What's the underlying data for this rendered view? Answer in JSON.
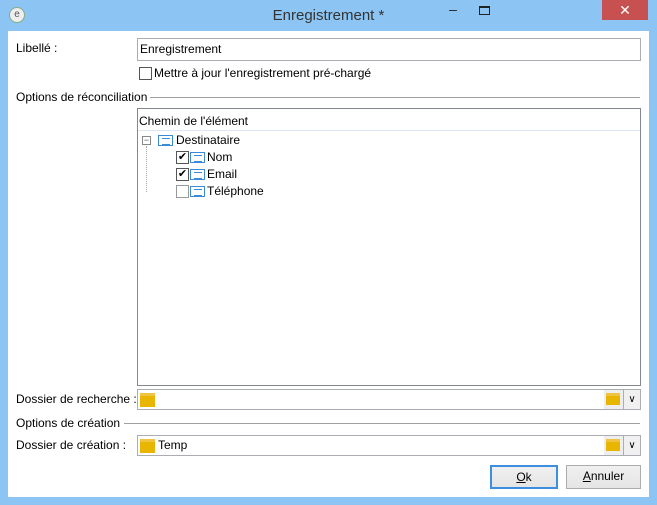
{
  "window": {
    "title": "Enregistrement *",
    "minimize": "‒",
    "close": "✕"
  },
  "form": {
    "label_label": "Libellé :",
    "label_value": "Enregistrement",
    "update_checkbox_label": "Mettre à jour l'enregistrement pré-chargé",
    "update_checked": false,
    "reconciliation_section": "Options de réconciliation",
    "tree": {
      "header": "Chemin de l'élément",
      "root": "Destinataire",
      "items": [
        {
          "label": "Nom",
          "checked": true
        },
        {
          "label": "Email",
          "checked": true
        },
        {
          "label": "Téléphone",
          "checked": false
        }
      ]
    },
    "search_folder_label": "Dossier de recherche :",
    "search_folder_value": "",
    "creation_section": "Options de création",
    "creation_folder_label": "Dossier de création :",
    "creation_folder_value": "Temp"
  },
  "buttons": {
    "ok_u": "O",
    "ok_rest": "k",
    "cancel_u": "A",
    "cancel_rest": "nnuler"
  }
}
